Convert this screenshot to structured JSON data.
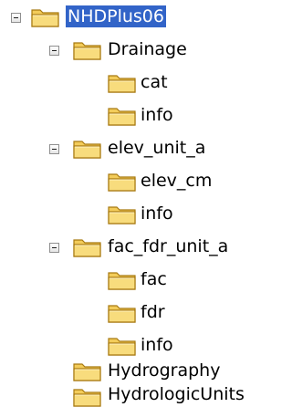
{
  "colors": {
    "selection_background": "#3264c8",
    "selection_text": "#ffffff",
    "folder_fill": "#f3cc5a",
    "folder_outline": "#a87a12"
  },
  "icons": {
    "folder": "folder-icon",
    "toggle": "collapse-toggle-icon"
  },
  "tree": {
    "root": {
      "label": "NHDPlus06",
      "selected": true,
      "expanded": true
    },
    "drainage": {
      "label": "Drainage",
      "expanded": true
    },
    "drainage_cat": {
      "label": "cat"
    },
    "drainage_info": {
      "label": "info"
    },
    "elev": {
      "label": "elev_unit_a",
      "expanded": true
    },
    "elev_cm": {
      "label": "elev_cm"
    },
    "elev_info": {
      "label": "info"
    },
    "fac_fdr": {
      "label": "fac_fdr_unit_a",
      "expanded": true
    },
    "fac": {
      "label": "fac"
    },
    "fdr": {
      "label": "fdr"
    },
    "fac_fdr_info": {
      "label": "info"
    },
    "hydrography": {
      "label": "Hydrography"
    },
    "hydrologic_units": {
      "label": "HydrologicUnits"
    }
  }
}
